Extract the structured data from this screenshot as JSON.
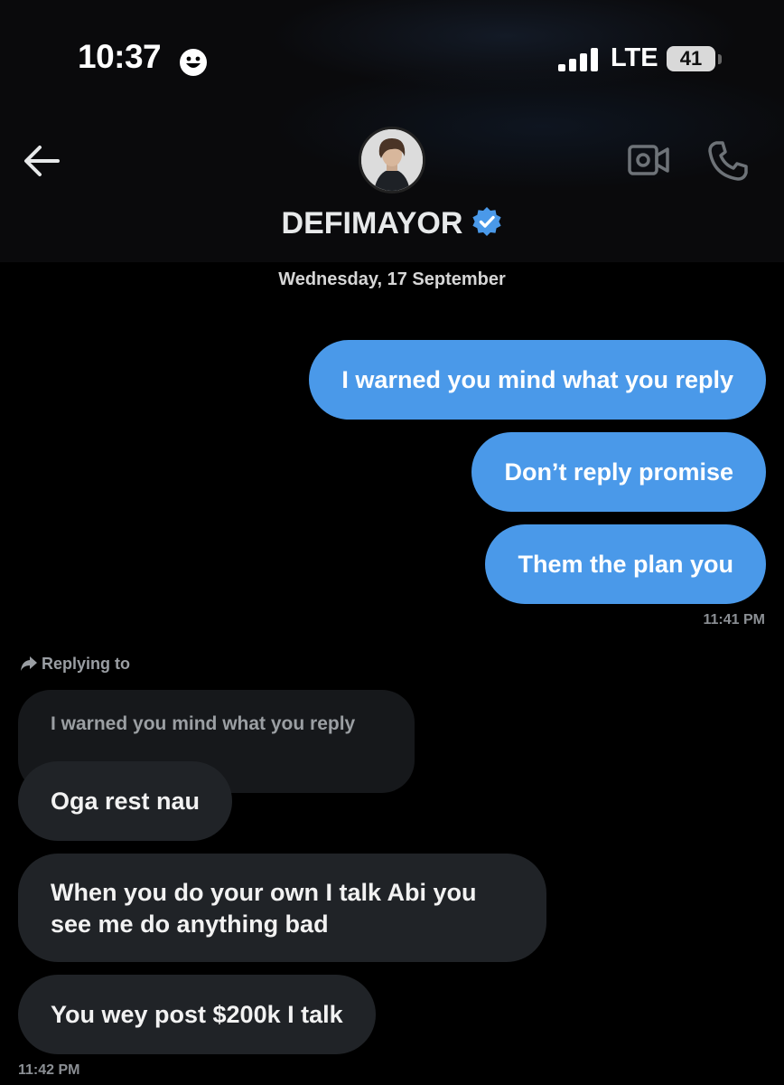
{
  "status_bar": {
    "time": "10:37",
    "network": "LTE",
    "battery": "41"
  },
  "header": {
    "contact_name": "DEFIMAYOR",
    "verified": true,
    "back_icon": "arrow-left-icon",
    "video_icon": "video-call-icon",
    "phone_icon": "phone-icon"
  },
  "conversation": {
    "date": "Wednesday, 17 September",
    "sent_messages": [
      "I warned you mind what you reply",
      "Don’t reply promise",
      "Them the plan you"
    ],
    "sent_time": "11:41 PM",
    "reply_label": "Replying to",
    "quoted_message": "I warned you mind what you reply",
    "received_messages": [
      "Oga rest nau",
      "When you do your own I talk Abi you see me do anything bad",
      "You wey post $200k I talk"
    ],
    "received_time": "11:42 PM"
  },
  "colors": {
    "sent_bubble": "#4a99e9",
    "received_bubble": "#202327",
    "verified_badge": "#4a99e9"
  }
}
